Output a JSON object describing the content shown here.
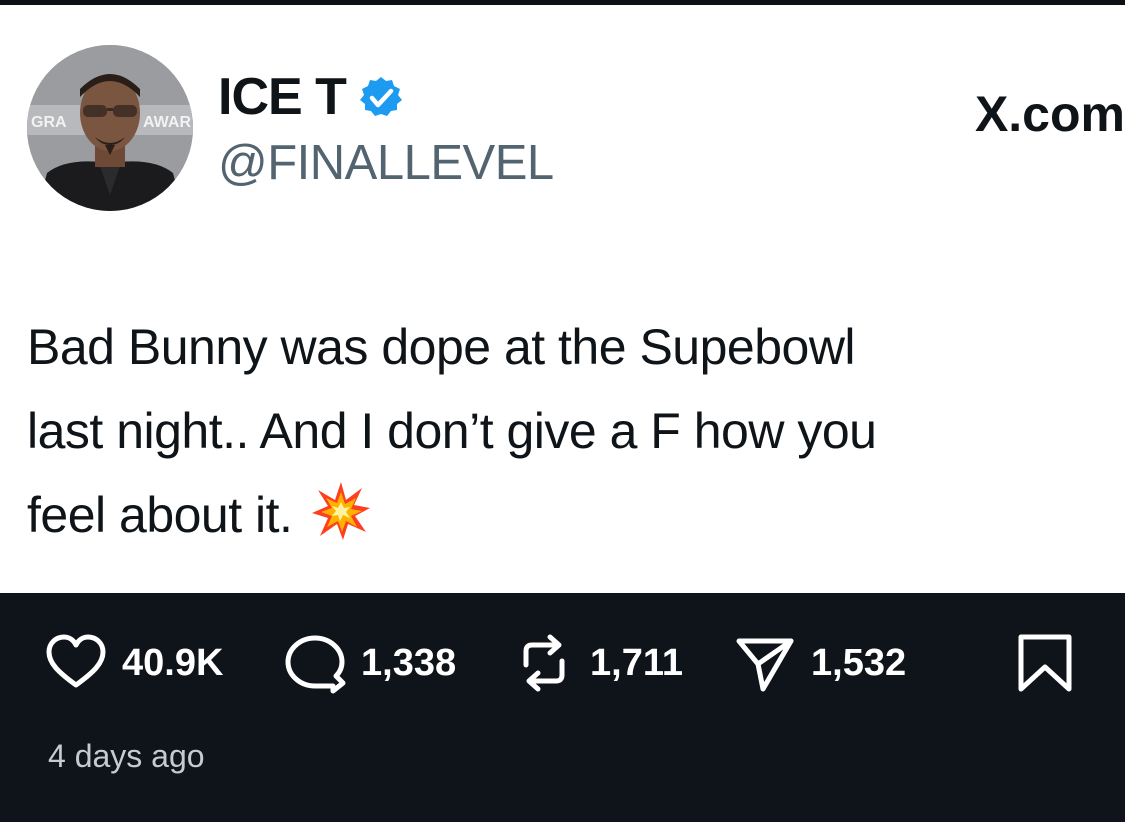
{
  "post": {
    "author": {
      "display_name": "ICE T",
      "handle": "@FINALLEVEL",
      "verified": true,
      "avatar_backdrop_text_left": "GRA",
      "avatar_backdrop_text_right": "AWAR"
    },
    "brand_label": "X.com",
    "text_lines": [
      "Bad Bunny was dope at the Supebowl",
      "last night.. And I don’t give a F how you",
      "feel about it."
    ],
    "emoji": "collision-icon",
    "stats": {
      "likes": "40.9K",
      "replies": "1,338",
      "reposts": "1,711",
      "shares": "1,532"
    },
    "timestamp": "4 days ago"
  },
  "colors": {
    "bar_background": "#0f141a",
    "verified_blue": "#1d9bf0",
    "handle_gray": "#536471"
  }
}
